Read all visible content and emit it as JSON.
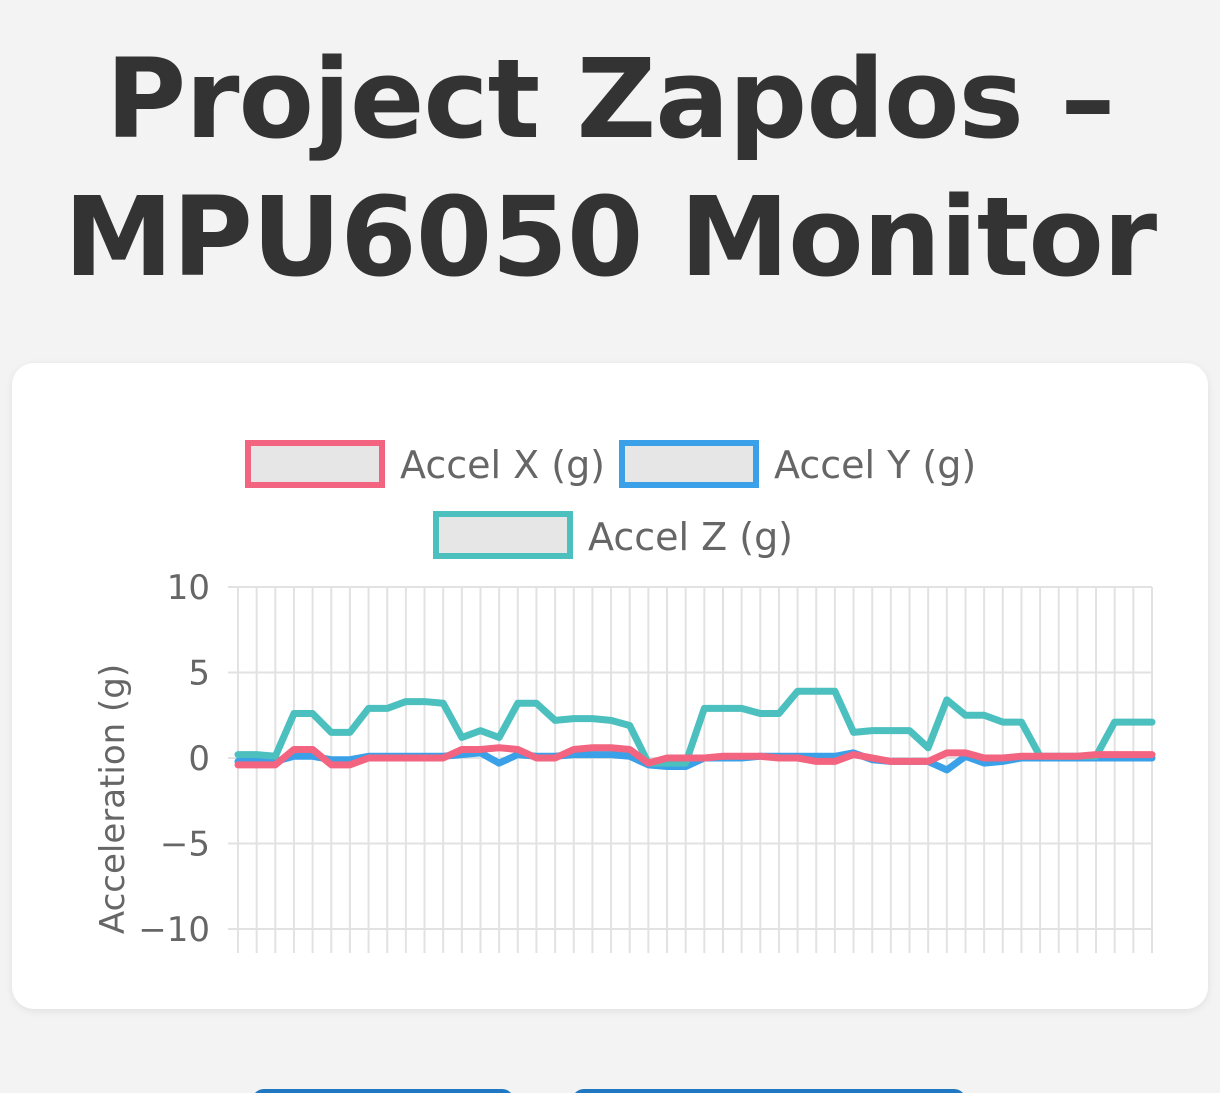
{
  "title": "Project Zapdos - MPU6050 Monitor",
  "title_lines": [
    "Project Zapdos –",
    "MPU6050 Monitor"
  ],
  "colors": {
    "background": "#f3f3f3",
    "card": "#ffffff",
    "accel_x": "#f2647f",
    "accel_y": "#3aa0e8",
    "accel_z": "#4cbfbf",
    "grid": "#e2e2e2",
    "text": "#333333",
    "button": "#2d8fd6"
  },
  "chart_data": {
    "type": "line",
    "title": "",
    "xlabel": "",
    "ylabel": "Acceleration (g)",
    "ylim": [
      -10,
      10
    ],
    "yticks": [
      "10",
      "5",
      "0",
      "−5",
      "−10"
    ],
    "ytick_values": [
      10,
      5,
      0,
      -5,
      -10
    ],
    "grid": true,
    "legend_position": "top",
    "point_count": 50,
    "series": [
      {
        "name": "Accel X (g)",
        "color": "#f2647f",
        "values": [
          -0.4,
          -0.4,
          -0.4,
          0.5,
          0.5,
          -0.4,
          -0.4,
          0.0,
          0.0,
          0.0,
          0.0,
          0.0,
          0.5,
          0.5,
          0.6,
          0.5,
          0.0,
          0.0,
          0.5,
          0.6,
          0.6,
          0.5,
          -0.3,
          0.0,
          0.0,
          0.0,
          0.1,
          0.1,
          0.1,
          0.0,
          0.0,
          -0.2,
          -0.2,
          0.2,
          0.0,
          -0.2,
          -0.2,
          -0.2,
          0.3,
          0.3,
          0.0,
          0.0,
          0.1,
          0.1,
          0.1,
          0.1,
          0.2,
          0.2,
          0.2,
          0.2
        ]
      },
      {
        "name": "Accel Y (g)",
        "color": "#3aa0e8",
        "values": [
          -0.2,
          -0.2,
          -0.2,
          0.1,
          0.1,
          -0.1,
          -0.1,
          0.1,
          0.1,
          0.1,
          0.1,
          0.1,
          0.2,
          0.3,
          -0.3,
          0.2,
          0.1,
          0.1,
          0.2,
          0.2,
          0.2,
          0.1,
          -0.4,
          -0.5,
          -0.5,
          0.0,
          0.0,
          0.0,
          0.1,
          0.1,
          0.1,
          0.1,
          0.1,
          0.3,
          -0.1,
          -0.2,
          -0.2,
          -0.2,
          -0.7,
          0.1,
          -0.3,
          -0.2,
          0.0,
          0.0,
          0.0,
          0.0,
          0.0,
          0.0,
          0.0,
          0.0
        ]
      },
      {
        "name": "Accel Z (g)",
        "color": "#4cbfbf",
        "values": [
          0.2,
          0.2,
          0.1,
          2.6,
          2.6,
          1.5,
          1.5,
          2.9,
          2.9,
          3.3,
          3.3,
          3.2,
          1.2,
          1.6,
          1.2,
          3.2,
          3.2,
          2.2,
          2.3,
          2.3,
          2.2,
          1.9,
          -0.3,
          -0.3,
          -0.3,
          2.9,
          2.9,
          2.9,
          2.6,
          2.6,
          3.9,
          3.9,
          3.9,
          1.5,
          1.6,
          1.6,
          1.6,
          0.6,
          3.4,
          2.5,
          2.5,
          2.1,
          2.1,
          0.1,
          0.1,
          0.1,
          0.1,
          2.1,
          2.1,
          2.1
        ]
      }
    ]
  }
}
